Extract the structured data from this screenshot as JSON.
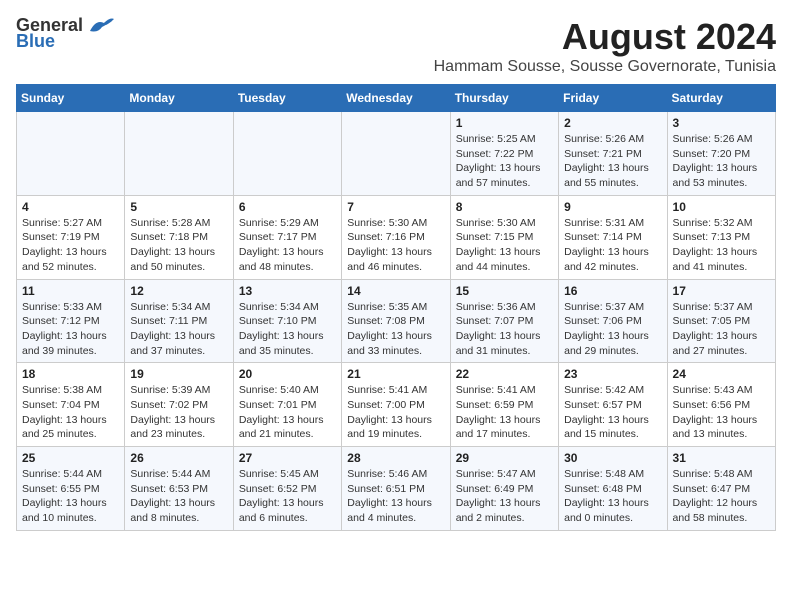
{
  "header": {
    "logo_general": "General",
    "logo_blue": "Blue",
    "title": "August 2024",
    "subtitle": "Hammam Sousse, Sousse Governorate, Tunisia"
  },
  "days_of_week": [
    "Sunday",
    "Monday",
    "Tuesday",
    "Wednesday",
    "Thursday",
    "Friday",
    "Saturday"
  ],
  "weeks": [
    [
      {
        "day": "",
        "info": ""
      },
      {
        "day": "",
        "info": ""
      },
      {
        "day": "",
        "info": ""
      },
      {
        "day": "",
        "info": ""
      },
      {
        "day": "1",
        "info": "Sunrise: 5:25 AM\nSunset: 7:22 PM\nDaylight: 13 hours\nand 57 minutes."
      },
      {
        "day": "2",
        "info": "Sunrise: 5:26 AM\nSunset: 7:21 PM\nDaylight: 13 hours\nand 55 minutes."
      },
      {
        "day": "3",
        "info": "Sunrise: 5:26 AM\nSunset: 7:20 PM\nDaylight: 13 hours\nand 53 minutes."
      }
    ],
    [
      {
        "day": "4",
        "info": "Sunrise: 5:27 AM\nSunset: 7:19 PM\nDaylight: 13 hours\nand 52 minutes."
      },
      {
        "day": "5",
        "info": "Sunrise: 5:28 AM\nSunset: 7:18 PM\nDaylight: 13 hours\nand 50 minutes."
      },
      {
        "day": "6",
        "info": "Sunrise: 5:29 AM\nSunset: 7:17 PM\nDaylight: 13 hours\nand 48 minutes."
      },
      {
        "day": "7",
        "info": "Sunrise: 5:30 AM\nSunset: 7:16 PM\nDaylight: 13 hours\nand 46 minutes."
      },
      {
        "day": "8",
        "info": "Sunrise: 5:30 AM\nSunset: 7:15 PM\nDaylight: 13 hours\nand 44 minutes."
      },
      {
        "day": "9",
        "info": "Sunrise: 5:31 AM\nSunset: 7:14 PM\nDaylight: 13 hours\nand 42 minutes."
      },
      {
        "day": "10",
        "info": "Sunrise: 5:32 AM\nSunset: 7:13 PM\nDaylight: 13 hours\nand 41 minutes."
      }
    ],
    [
      {
        "day": "11",
        "info": "Sunrise: 5:33 AM\nSunset: 7:12 PM\nDaylight: 13 hours\nand 39 minutes."
      },
      {
        "day": "12",
        "info": "Sunrise: 5:34 AM\nSunset: 7:11 PM\nDaylight: 13 hours\nand 37 minutes."
      },
      {
        "day": "13",
        "info": "Sunrise: 5:34 AM\nSunset: 7:10 PM\nDaylight: 13 hours\nand 35 minutes."
      },
      {
        "day": "14",
        "info": "Sunrise: 5:35 AM\nSunset: 7:08 PM\nDaylight: 13 hours\nand 33 minutes."
      },
      {
        "day": "15",
        "info": "Sunrise: 5:36 AM\nSunset: 7:07 PM\nDaylight: 13 hours\nand 31 minutes."
      },
      {
        "day": "16",
        "info": "Sunrise: 5:37 AM\nSunset: 7:06 PM\nDaylight: 13 hours\nand 29 minutes."
      },
      {
        "day": "17",
        "info": "Sunrise: 5:37 AM\nSunset: 7:05 PM\nDaylight: 13 hours\nand 27 minutes."
      }
    ],
    [
      {
        "day": "18",
        "info": "Sunrise: 5:38 AM\nSunset: 7:04 PM\nDaylight: 13 hours\nand 25 minutes."
      },
      {
        "day": "19",
        "info": "Sunrise: 5:39 AM\nSunset: 7:02 PM\nDaylight: 13 hours\nand 23 minutes."
      },
      {
        "day": "20",
        "info": "Sunrise: 5:40 AM\nSunset: 7:01 PM\nDaylight: 13 hours\nand 21 minutes."
      },
      {
        "day": "21",
        "info": "Sunrise: 5:41 AM\nSunset: 7:00 PM\nDaylight: 13 hours\nand 19 minutes."
      },
      {
        "day": "22",
        "info": "Sunrise: 5:41 AM\nSunset: 6:59 PM\nDaylight: 13 hours\nand 17 minutes."
      },
      {
        "day": "23",
        "info": "Sunrise: 5:42 AM\nSunset: 6:57 PM\nDaylight: 13 hours\nand 15 minutes."
      },
      {
        "day": "24",
        "info": "Sunrise: 5:43 AM\nSunset: 6:56 PM\nDaylight: 13 hours\nand 13 minutes."
      }
    ],
    [
      {
        "day": "25",
        "info": "Sunrise: 5:44 AM\nSunset: 6:55 PM\nDaylight: 13 hours\nand 10 minutes."
      },
      {
        "day": "26",
        "info": "Sunrise: 5:44 AM\nSunset: 6:53 PM\nDaylight: 13 hours\nand 8 minutes."
      },
      {
        "day": "27",
        "info": "Sunrise: 5:45 AM\nSunset: 6:52 PM\nDaylight: 13 hours\nand 6 minutes."
      },
      {
        "day": "28",
        "info": "Sunrise: 5:46 AM\nSunset: 6:51 PM\nDaylight: 13 hours\nand 4 minutes."
      },
      {
        "day": "29",
        "info": "Sunrise: 5:47 AM\nSunset: 6:49 PM\nDaylight: 13 hours\nand 2 minutes."
      },
      {
        "day": "30",
        "info": "Sunrise: 5:48 AM\nSunset: 6:48 PM\nDaylight: 13 hours\nand 0 minutes."
      },
      {
        "day": "31",
        "info": "Sunrise: 5:48 AM\nSunset: 6:47 PM\nDaylight: 12 hours\nand 58 minutes."
      }
    ]
  ]
}
